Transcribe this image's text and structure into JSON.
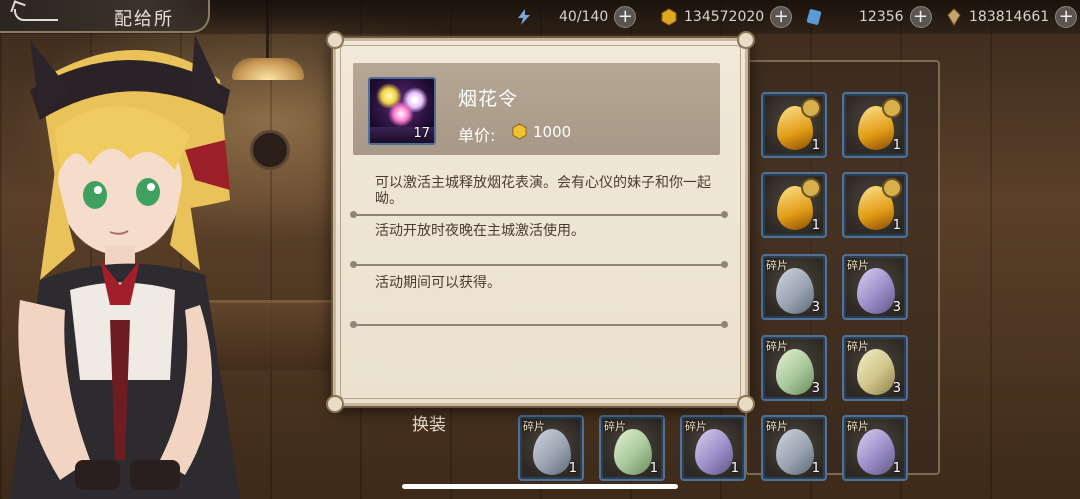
{
  "header": {
    "title": "配给所"
  },
  "resources": {
    "energy": {
      "value": "40/140",
      "icon": "lightning-icon"
    },
    "gold": {
      "value": "134572020",
      "icon": "gold-coin-icon"
    },
    "cards": {
      "value": "12356",
      "icon": "card-icon"
    },
    "shards": {
      "value": "183814661",
      "icon": "shard-icon"
    },
    "plus_label": "+"
  },
  "modal": {
    "item_name": "烟花令",
    "item_quantity": "17",
    "price_label": "单价:",
    "price_value": "1000",
    "descriptions": [
      "可以激活主城释放烟花表演。会有心仪的妹子和你一起呦。",
      "活动开放时夜晚在主城激活使用。",
      "活动期间可以获得。"
    ]
  },
  "inventory": {
    "slots": [
      {
        "type": "medal-gem",
        "count": "1"
      },
      {
        "type": "medal-gem",
        "count": "1"
      },
      {
        "type": "gem",
        "count": "1"
      },
      {
        "type": "gem",
        "count": "1"
      },
      {
        "type": "fragment",
        "tag": "碎片",
        "count": "3"
      },
      {
        "type": "fragment",
        "tag": "碎片",
        "count": "3"
      },
      {
        "type": "fragment",
        "tag": "碎片",
        "count": "3"
      },
      {
        "type": "fragment",
        "tag": "碎片",
        "count": "3"
      }
    ],
    "bottom_slots": [
      {
        "tag": "碎片",
        "count": "1"
      },
      {
        "tag": "碎片",
        "count": "1"
      },
      {
        "tag": "碎片",
        "count": "1"
      },
      {
        "tag": "碎片",
        "count": "1"
      },
      {
        "tag": "碎片",
        "count": "1"
      }
    ]
  },
  "side": {
    "change_outfit": "换装"
  },
  "colors": {
    "modal_bg": "#ece1cf",
    "slot_border": "#4f7398",
    "accent_gold": "#e0a81c"
  }
}
